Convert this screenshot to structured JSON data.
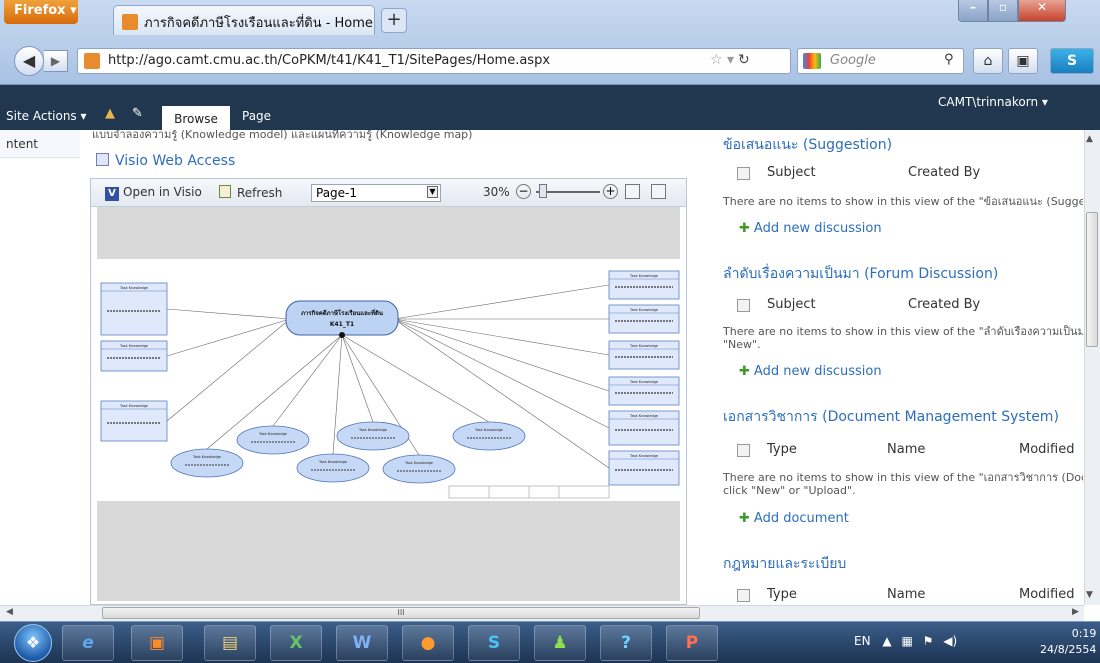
{
  "browser": {
    "menu_label": "Firefox",
    "tab_title": "ภารกิจคดีภาษีโรงเรือนและที่ดิน - Home",
    "new_tab_label": "+",
    "url": "http://ago.camt.cmu.ac.th/CoPKM/t41/K41_T1/SitePages/Home.aspx",
    "search_placeholder": "Google"
  },
  "ribbon": {
    "site_actions": "Site Actions",
    "tabs": [
      "Browse",
      "Page"
    ],
    "active_tab": "Browse",
    "user": "CAMT\\trinnakorn"
  },
  "leftnav": {
    "item": "ntent"
  },
  "visio": {
    "top_text": "แบบจำลองความรู้ (Knowledge model) และแผนที่ความรู้ (Knowledge map)",
    "title": "Visio Web Access",
    "open_label": "Open in Visio",
    "refresh_label": "Refresh",
    "page_select": "Page-1",
    "zoom": "30%",
    "diagram_center": [
      "ภารกิจคดีภาษีโรงเรือนและที่ดิน",
      "K41_T1"
    ],
    "task_box_header": "Task Knowledge"
  },
  "right": {
    "suggestion": {
      "title": "ข้อเสนอแนะ (Suggestion)",
      "col1": "Subject",
      "col2": "Created By",
      "empty": "There are no items to show in this view of the \"ข้อเสนอแนะ (Suggestic",
      "add": "Add new discussion"
    },
    "forum": {
      "title": "ลำดับเรื่องความเป็นมา (Forum Discussion)",
      "col1": "Subject",
      "col2": "Created By",
      "empty1": "There are no items to show in this view of the \"ลำดับเรื่องความเป็นมา (",
      "empty2": "\"New\".",
      "add": "Add new discussion"
    },
    "docs": {
      "title": "เอกสารวิชาการ (Document Management System)",
      "col1": "Type",
      "col2": "Name",
      "col3": "Modified",
      "empty1": "There are no items to show in this view of the \"เอกสารวิชาการ (Docum",
      "empty2": "click \"New\" or \"Upload\".",
      "add": "Add document"
    },
    "law": {
      "title": "กฎหมายและระเบียบ",
      "col1": "Type",
      "col2": "Name",
      "col3": "Modified"
    }
  },
  "scroll": {
    "h_thumb": "III"
  },
  "taskbar": {
    "lang": "EN",
    "time": "0:19",
    "date": "24/8/2554",
    "apps": [
      "ie-icon",
      "media-icon",
      "explorer-icon",
      "excel-icon",
      "word-icon",
      "firefox-icon",
      "skype-icon",
      "messenger-icon",
      "network-icon",
      "powerpoint-icon"
    ]
  },
  "colors": {
    "ribbon": "#21374f",
    "link": "#2c6ebd",
    "firefox_orange": "#d76a0c"
  }
}
